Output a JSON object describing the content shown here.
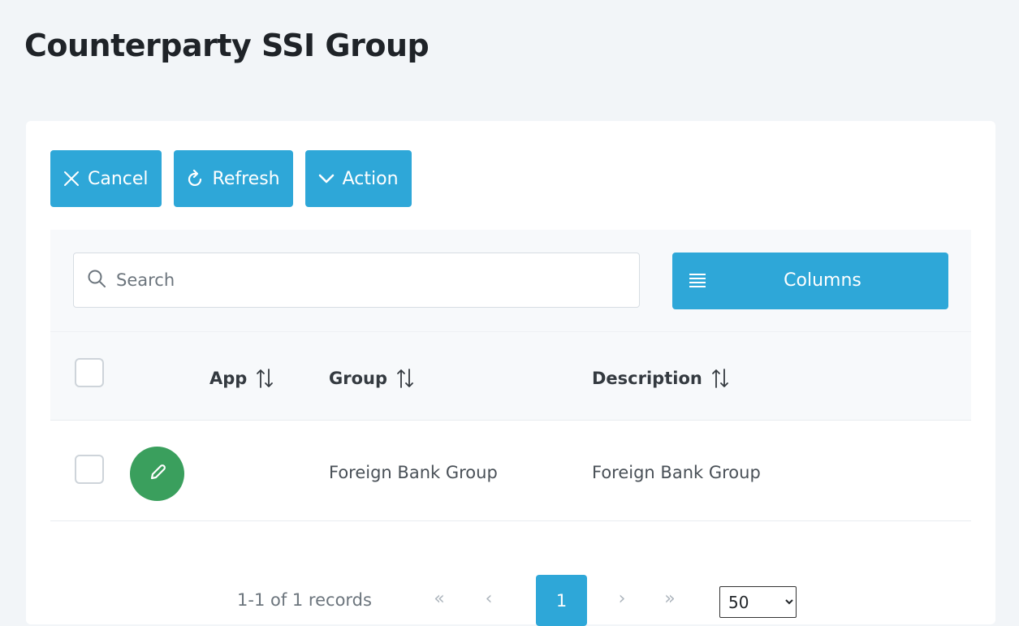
{
  "page": {
    "title": "Counterparty SSI Group"
  },
  "toolbar": {
    "cancel_label": "Cancel",
    "refresh_label": "Refresh",
    "action_label": "Action"
  },
  "search": {
    "placeholder": "Search",
    "value": ""
  },
  "columns_button": {
    "label": "Columns"
  },
  "table": {
    "headers": {
      "app": "App",
      "group": "Group",
      "description": "Description"
    },
    "rows": [
      {
        "app": "",
        "group": "Foreign Bank Group",
        "description": "Foreign Bank Group"
      }
    ]
  },
  "pagination": {
    "record_text": "1-1 of 1 records",
    "first": "«",
    "prev": "‹",
    "current_page": "1",
    "next": "›",
    "last": "»",
    "rows_per_page": "50",
    "rows_per_page_options": [
      "50"
    ]
  },
  "colors": {
    "accent": "#2ea7d8",
    "edit_button": "#3a9f5d",
    "background": "#f2f5f8"
  },
  "icons": {
    "cancel": "close-icon",
    "refresh": "refresh-icon",
    "action": "chevron-down-icon",
    "search": "search-icon",
    "columns": "list-icon",
    "sort": "sort-icon",
    "edit": "pencil-icon"
  }
}
